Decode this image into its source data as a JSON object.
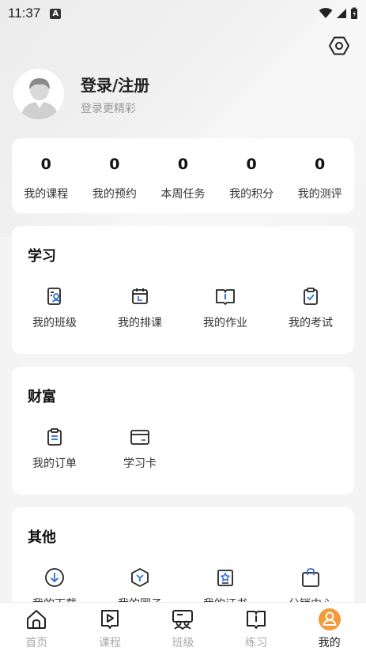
{
  "status_bar": {
    "time": "11:37",
    "badge": "A"
  },
  "profile": {
    "title": "登录/注册",
    "subtitle": "登录更精彩"
  },
  "stats": [
    {
      "value": "0",
      "label": "我的课程"
    },
    {
      "value": "0",
      "label": "我的预约"
    },
    {
      "value": "0",
      "label": "本周任务"
    },
    {
      "value": "0",
      "label": "我的积分"
    },
    {
      "value": "0",
      "label": "我的测评"
    }
  ],
  "study": {
    "title": "学习",
    "items": [
      {
        "label": "我的班级",
        "icon": "class-card-icon"
      },
      {
        "label": "我的排课",
        "icon": "calendar-icon"
      },
      {
        "label": "我的作业",
        "icon": "book-icon"
      },
      {
        "label": "我的考试",
        "icon": "exam-clipboard-icon"
      }
    ]
  },
  "wealth": {
    "title": "财富",
    "items": [
      {
        "label": "我的订单",
        "icon": "order-clipboard-icon"
      },
      {
        "label": "学习卡",
        "icon": "card-icon"
      }
    ]
  },
  "other": {
    "title": "其他",
    "items": [
      {
        "label": "我的下载",
        "icon": "download-icon"
      },
      {
        "label": "我的圈子",
        "icon": "circle-icon"
      },
      {
        "label": "我的证书",
        "icon": "certificate-icon"
      },
      {
        "label": "分销中心",
        "icon": "bag-icon"
      }
    ]
  },
  "tabbar": [
    {
      "label": "首页",
      "icon": "home-icon"
    },
    {
      "label": "课程",
      "icon": "course-icon"
    },
    {
      "label": "班级",
      "icon": "class-icon"
    },
    {
      "label": "练习",
      "icon": "practice-icon"
    },
    {
      "label": "我的",
      "icon": "profile-icon",
      "active": true
    }
  ],
  "colors": {
    "accent": "#f39a3b",
    "icon_blue": "#2f6fd6"
  }
}
